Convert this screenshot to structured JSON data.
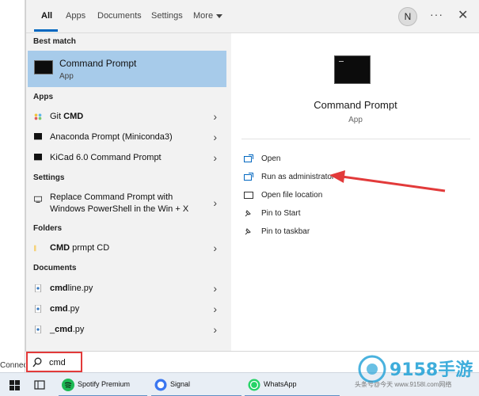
{
  "tabs": {
    "all": "All",
    "apps": "Apps",
    "documents": "Documents",
    "settings": "Settings",
    "more": "More"
  },
  "header": {
    "avatar_initial": "N",
    "more_options": "···",
    "close": "✕"
  },
  "results": {
    "best_match_title": "Best match",
    "best_match": {
      "name": "Command Prompt",
      "type": "App"
    },
    "apps_title": "Apps",
    "apps": [
      {
        "name_prefix": "Git ",
        "name_bold": "CMD"
      },
      {
        "name": "Anaconda Prompt (Miniconda3)"
      },
      {
        "name": "KiCad 6.0 Command Prompt"
      }
    ],
    "settings_title": "Settings",
    "settings": [
      {
        "line1": "Replace Command Prompt with",
        "line2": "Windows PowerShell in the Win + X"
      }
    ],
    "folders_title": "Folders",
    "folders": [
      {
        "name_bold": "CMD",
        "name_suffix": " prmpt CD"
      }
    ],
    "documents_title": "Documents",
    "documents": [
      {
        "name_bold": "cmd",
        "name_suffix": "line.py"
      },
      {
        "name_bold": "cmd",
        "name_suffix": ".py"
      },
      {
        "name_prefix": "_",
        "name_bold": "cmd",
        "name_suffix": ".py"
      }
    ]
  },
  "detail": {
    "title": "Command Prompt",
    "subtitle": "App",
    "actions": [
      {
        "label": "Open",
        "icon": "open-icon"
      },
      {
        "label": "Run as administrator",
        "icon": "shield-admin-icon"
      },
      {
        "label": "Open file location",
        "icon": "folder-location-icon"
      },
      {
        "label": "Pin to Start",
        "icon": "pin-icon"
      },
      {
        "label": "Pin to taskbar",
        "icon": "pin-icon"
      }
    ]
  },
  "search": {
    "value": "cmd"
  },
  "side": {
    "connect_text": "Connec"
  },
  "taskbar": {
    "items": [
      {
        "label": "Spotify Premium",
        "icon": "spotify-icon"
      },
      {
        "label": "Signal",
        "icon": "signal-icon"
      },
      {
        "label": "WhatsApp",
        "icon": "whatsapp-icon"
      }
    ]
  },
  "watermark": {
    "logo_text": "9158手游",
    "caption": "头条号@今天 www.9158l.com网络"
  },
  "colors": {
    "selection": "#a7cbea",
    "accent": "#0067c0",
    "annotation_red": "#e23a3a"
  }
}
